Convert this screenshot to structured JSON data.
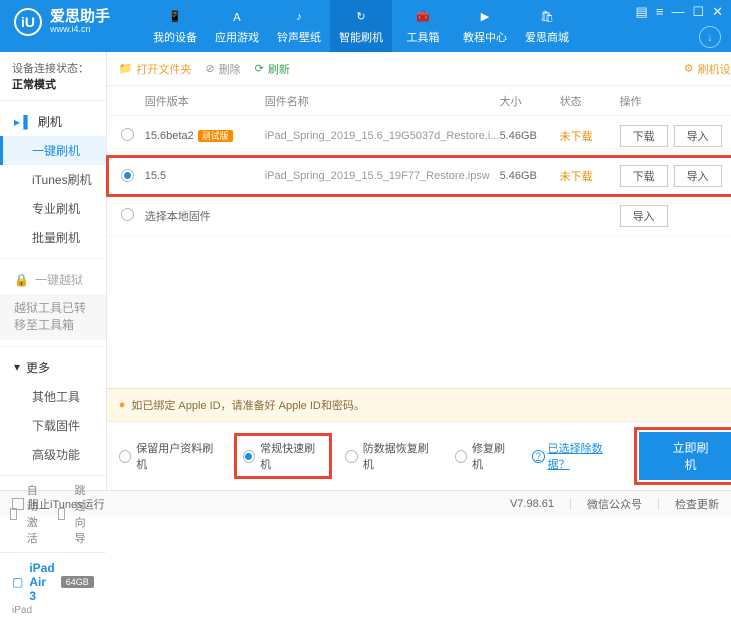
{
  "brand": {
    "cn": "爱思助手",
    "url": "www.i4.cn"
  },
  "nav": {
    "device": "我的设备",
    "apps": "应用游戏",
    "ring": "铃声壁纸",
    "flash": "智能刷机",
    "tools": "工具箱",
    "tutorial": "教程中心",
    "store": "爱思商城"
  },
  "side": {
    "status_label": "设备连接状态：",
    "status_value": "正常模式",
    "flash_head": "刷机",
    "items": {
      "oneclick": "一键刷机",
      "itunes": "iTunes刷机",
      "pro": "专业刷机",
      "batch": "批量刷机"
    },
    "jailbreak_head": "一键越狱",
    "jb_note": "越狱工具已转移至工具箱",
    "more_head": "更多",
    "more": {
      "other": "其他工具",
      "downloaded": "下载固件",
      "adv": "高级功能"
    },
    "auto_act": "自动激活",
    "skip_guide": "跳过向导"
  },
  "device": {
    "name": "iPad Air 3",
    "storage": "64GB",
    "model": "iPad"
  },
  "toolbar": {
    "open": "打开文件夹",
    "delete": "删除",
    "refresh": "刷新",
    "settings": "刷机设置"
  },
  "thead": {
    "ver": "固件版本",
    "name": "固件名称",
    "size": "大小",
    "status": "状态",
    "ops": "操作"
  },
  "rows": [
    {
      "ver": "15.6beta2",
      "beta": "测试版",
      "name": "iPad_Spring_2019_15.6_19G5037d_Restore.i...",
      "size": "5.46GB",
      "status": "未下载",
      "download": "下载",
      "import": "导入",
      "selected": false
    },
    {
      "ver": "15.5",
      "beta": "",
      "name": "iPad_Spring_2019_15.5_19F77_Restore.ipsw",
      "size": "5.46GB",
      "status": "未下载",
      "download": "下载",
      "import": "导入",
      "selected": true
    }
  ],
  "local_row": {
    "label": "选择本地固件",
    "import": "导入"
  },
  "alert": "如已绑定 Apple ID，请准备好 Apple ID和密码。",
  "options": {
    "keep": "保留用户资料刷机",
    "normal": "常规快速刷机",
    "recover": "防数据恢复刷机",
    "repair": "修复刷机",
    "exclude": "已选择除数据？",
    "go": "立即刷机"
  },
  "footer": {
    "block": "阻止iTunes运行",
    "ver": "V7.98.61",
    "wechat": "微信公众号",
    "check": "检查更新"
  }
}
